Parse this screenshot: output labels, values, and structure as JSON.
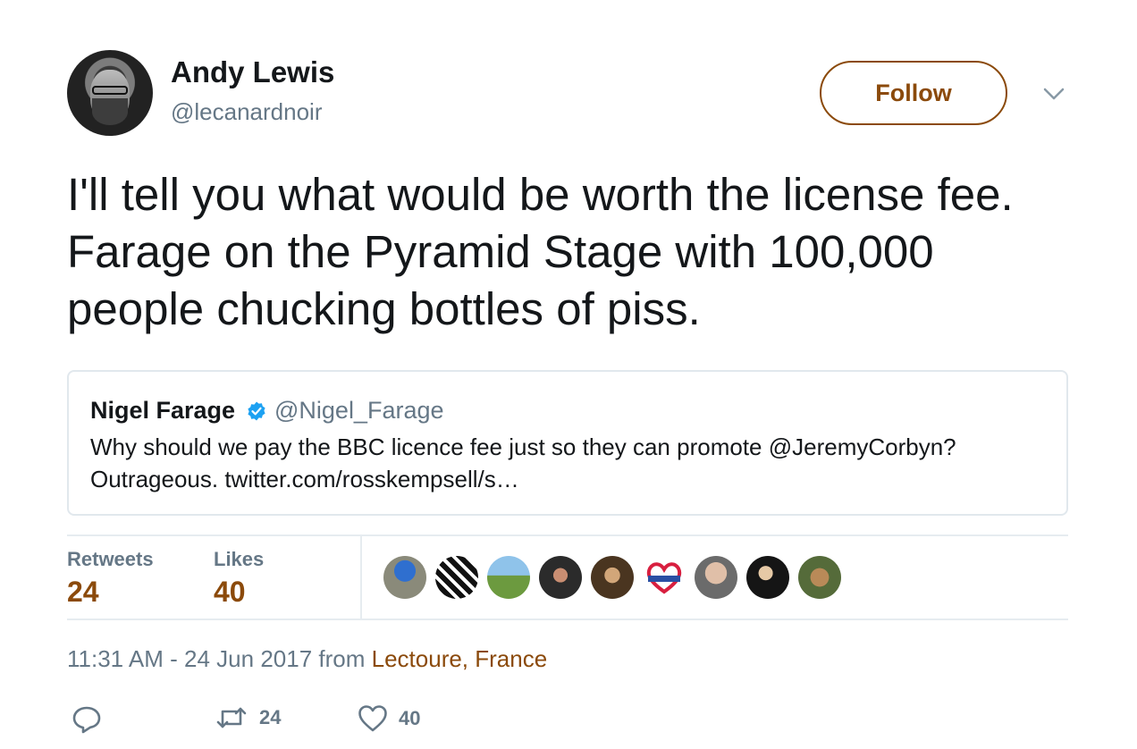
{
  "author": {
    "name": "Andy Lewis",
    "handle": "@lecanardnoir"
  },
  "follow_label": "Follow",
  "tweet_text": "I'll tell you what would be worth the license fee. Farage on the Pyramid Stage with 100,000 people chucking bottles of piss.",
  "quoted_tweet": {
    "name": "Nigel Farage",
    "handle": "@Nigel_Farage",
    "verified": true,
    "text": "Why should we pay the BBC licence fee just so they can promote @JeremyCorbyn? Outrageous. twitter.com/rosskempsell/s…"
  },
  "stats": {
    "retweets_label": "Retweets",
    "retweets_value": "24",
    "likes_label": "Likes",
    "likes_value": "40"
  },
  "likers": [
    {
      "icon": "cat-in-blue-hat-avatar"
    },
    {
      "icon": "black-white-pattern-avatar"
    },
    {
      "icon": "person-with-bike-avatar"
    },
    {
      "icon": "person-portrait-avatar"
    },
    {
      "icon": "man-with-glasses-avatar"
    },
    {
      "icon": "heart-banner-avatar"
    },
    {
      "icon": "bald-man-avatar"
    },
    {
      "icon": "woman-portrait-avatar"
    },
    {
      "icon": "cat-avatar"
    }
  ],
  "timestamp": {
    "time_date": "11:31 AM - 24 Jun 2017 from",
    "location": "Lectoure, France"
  },
  "actions": {
    "reply_icon": "reply-icon",
    "retweet_count": "24",
    "like_count": "40"
  },
  "colors": {
    "accent": "#8b4a0b",
    "secondary_text": "#657786",
    "verified_blue": "#1da1f2",
    "border": "#e1e8ed"
  }
}
